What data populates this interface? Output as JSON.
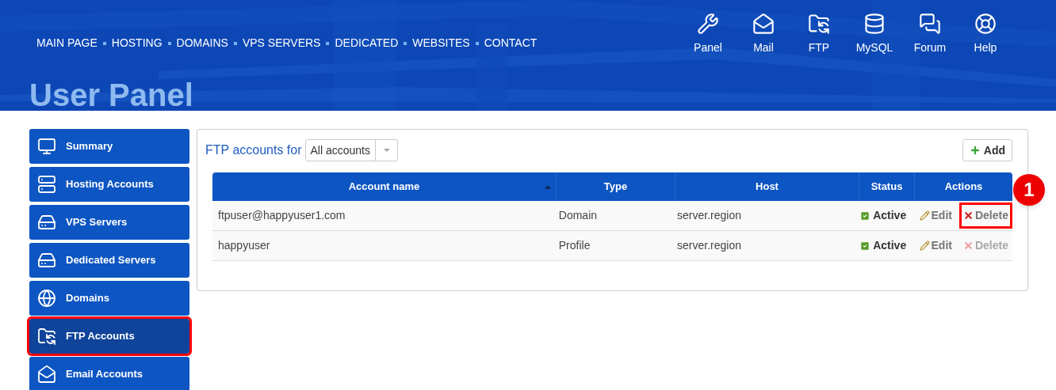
{
  "nav": [
    "MAIN PAGE",
    "HOSTING",
    "DOMAINS",
    "VPS SERVERS",
    "DEDICATED",
    "WEBSITES",
    "CONTACT"
  ],
  "header_links": [
    {
      "label": "Panel",
      "kind": "tools"
    },
    {
      "label": "Mail",
      "kind": "mail"
    },
    {
      "label": "FTP",
      "kind": "ftp"
    },
    {
      "label": "MySQL",
      "kind": "database"
    },
    {
      "label": "Forum",
      "kind": "forum"
    },
    {
      "label": "Help",
      "kind": "help"
    }
  ],
  "page_title": "User Panel",
  "sidebar": {
    "items": [
      {
        "label": "Summary",
        "kind": "monitor",
        "selected": false,
        "highlighted": false
      },
      {
        "label": "Hosting Accounts",
        "kind": "rack",
        "selected": false,
        "highlighted": false
      },
      {
        "label": "VPS Servers",
        "kind": "tower",
        "selected": false,
        "highlighted": false
      },
      {
        "label": "Dedicated Servers",
        "kind": "tower",
        "selected": false,
        "highlighted": false
      },
      {
        "label": "Domains",
        "kind": "globe",
        "selected": false,
        "highlighted": false
      },
      {
        "label": "FTP Accounts",
        "kind": "ftp",
        "selected": true,
        "highlighted": true
      },
      {
        "label": "Email Accounts",
        "kind": "mail",
        "selected": false,
        "highlighted": false
      }
    ]
  },
  "filter": {
    "label": "FTP accounts for",
    "value": "All accounts"
  },
  "add_button": "Add",
  "table": {
    "columns": [
      {
        "label": "Account name",
        "sorted": true
      },
      {
        "label": "Type",
        "sorted": false
      },
      {
        "label": "Host",
        "sorted": false
      },
      {
        "label": "Status",
        "sorted": false
      },
      {
        "label": "Actions",
        "sorted": false
      }
    ],
    "rows": [
      {
        "name": "ftpuser@happyuser1.com",
        "type": "Domain",
        "host": "server.region",
        "status": "Active",
        "actions": [
          {
            "label": "Edit",
            "kind": "edit",
            "disabled": false,
            "highlighted": false
          },
          {
            "label": "Delete",
            "kind": "delete",
            "disabled": false,
            "highlighted": true
          }
        ]
      },
      {
        "name": "happyuser",
        "type": "Profile",
        "host": "server.region",
        "status": "Active",
        "actions": [
          {
            "label": "Edit",
            "kind": "edit",
            "disabled": false,
            "highlighted": false
          },
          {
            "label": "Delete",
            "kind": "delete",
            "disabled": true,
            "highlighted": false
          }
        ]
      }
    ]
  },
  "annotation": "1"
}
